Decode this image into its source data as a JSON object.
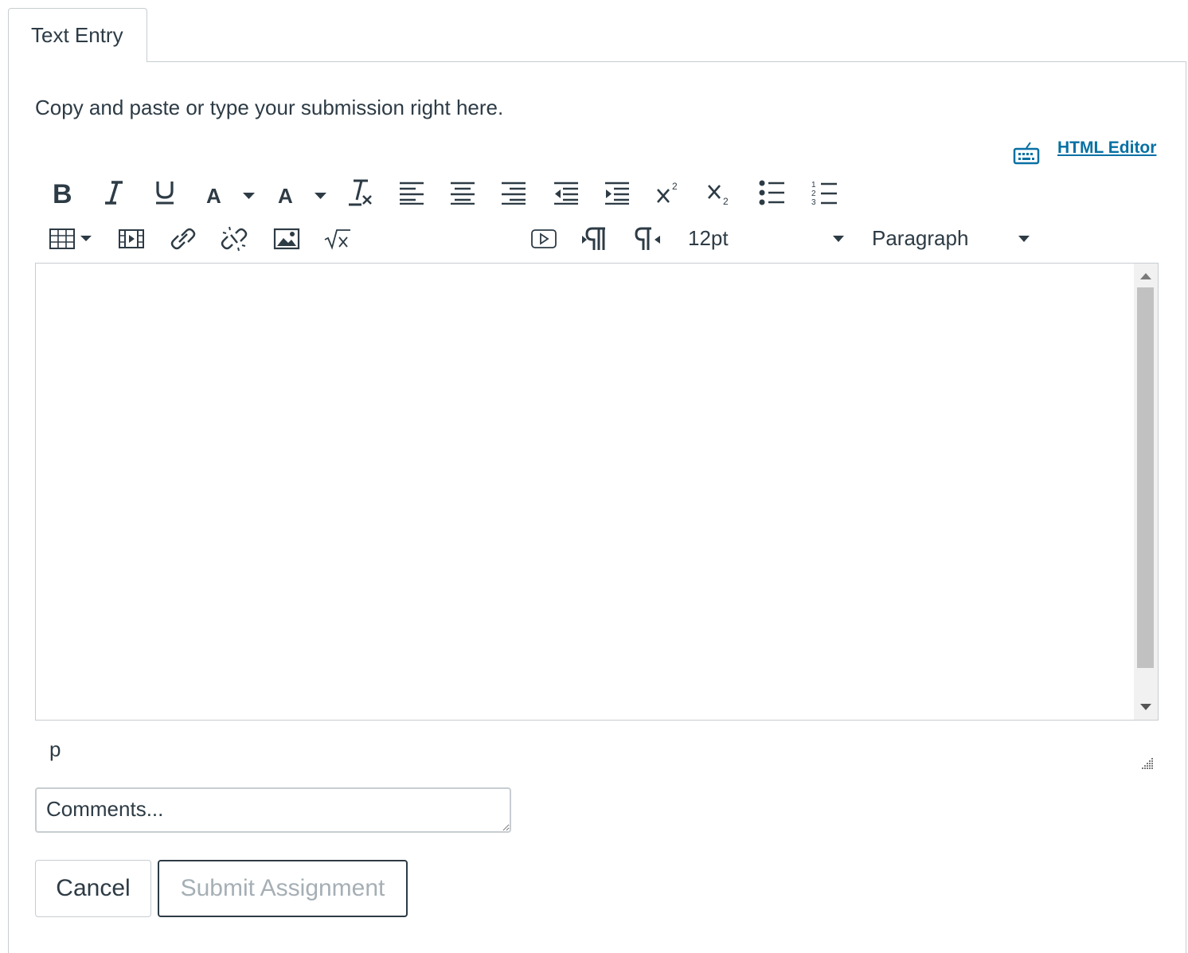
{
  "tabs": [
    {
      "label": "Text Entry",
      "active": true
    }
  ],
  "instructions": "Copy and paste or type your submission right here.",
  "html_editor_link": "HTML Editor",
  "toolbar": {
    "row1_icons": [
      "bold-icon",
      "italic-icon",
      "underline-icon",
      "text-color-icon",
      "background-color-icon",
      "clear-formatting-icon",
      "align-left-icon",
      "align-center-icon",
      "align-right-icon",
      "outdent-icon",
      "indent-icon",
      "superscript-icon",
      "subscript-icon",
      "bullet-list-icon",
      "numbered-list-icon"
    ],
    "row2_icons": [
      "table-icon",
      "media-icon",
      "link-icon",
      "unlink-icon",
      "image-icon",
      "math-icon",
      "embed-icon",
      "ltr-icon",
      "rtl-icon"
    ],
    "font_size": "12pt",
    "block_format": "Paragraph"
  },
  "editor": {
    "content": "",
    "path": "p"
  },
  "comments": {
    "placeholder": "Comments..."
  },
  "buttons": {
    "cancel": "Cancel",
    "submit": "Submit Assignment"
  },
  "colors": {
    "text": "#2d3b45",
    "link": "#0770a3",
    "border": "#c7cdd1",
    "disabled": "#a5afb5"
  }
}
